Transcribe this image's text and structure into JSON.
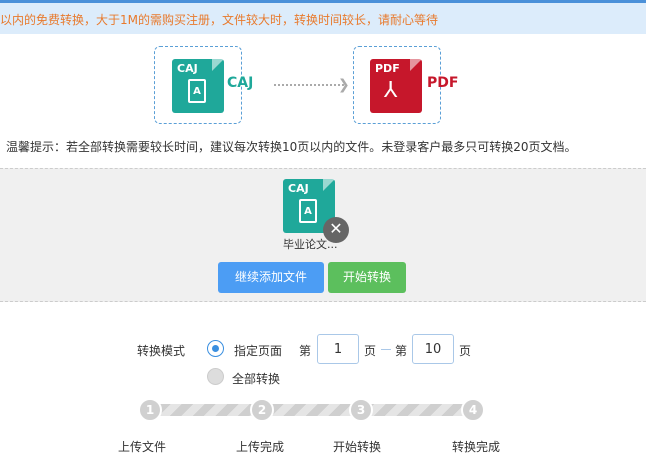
{
  "notice": "以内的免费转换，大于1M的需购买注册，文件较大时，转换时间较长，请耐心等待",
  "formats": {
    "source": {
      "icon_text": "CAJ",
      "label": "CAJ",
      "color": "#1fa89a",
      "icon": "caj-file-icon"
    },
    "target": {
      "icon_text": "PDF",
      "label": "PDF",
      "color": "#c6172b",
      "icon": "pdf-file-icon"
    }
  },
  "tip": "温馨提示：若全部转换需要较长时间，建议每次转换10页以内的文件。未登录客户最多只可转换20页文档。",
  "uploaded_file": {
    "icon_text": "CAJ",
    "name": "毕业论文..."
  },
  "buttons": {
    "add": "继续添加文件",
    "start": "开始转换"
  },
  "mode": {
    "label": "转换模式",
    "option_pages": "指定页面",
    "option_all": "全部转换",
    "from_prefix": "第",
    "from_value": "1",
    "mid_text": "页",
    "to_prefix": "第",
    "to_value": "10",
    "suffix": "页"
  },
  "steps": [
    {
      "num": "1",
      "label": "上传文件"
    },
    {
      "num": "2",
      "label": "上传完成"
    },
    {
      "num": "3",
      "label": "开始转换"
    },
    {
      "num": "4",
      "label": "转换完成"
    }
  ]
}
